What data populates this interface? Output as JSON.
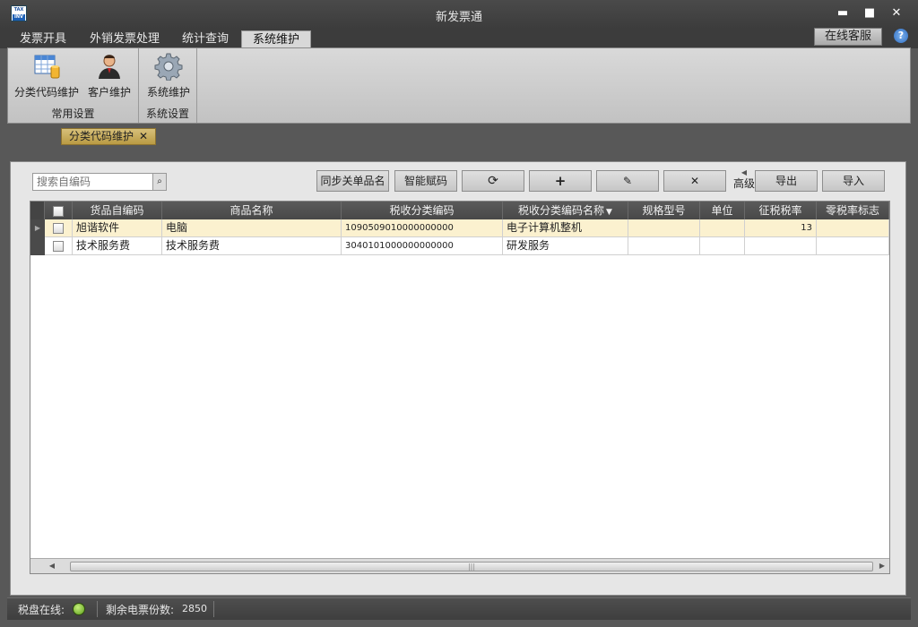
{
  "window": {
    "title": "新发票通",
    "minimize": "▬",
    "maximize": "■",
    "close": "✕"
  },
  "app_icon": {
    "line1": "TAX",
    "line2": "INV"
  },
  "menu": {
    "tabs": [
      "发票开具",
      "外销发票处理",
      "统计查询",
      "系统维护"
    ],
    "active": "系统维护"
  },
  "service_button": "在线客服",
  "help": "?",
  "ribbon": {
    "groups": [
      {
        "label": "常用设置",
        "buttons": [
          {
            "label": "分类代码维护",
            "icon": "spreadsheet-icon"
          },
          {
            "label": "客户维护",
            "icon": "user-icon"
          }
        ]
      },
      {
        "label": "系统设置",
        "buttons": [
          {
            "label": "系统维护",
            "icon": "gear-icon"
          }
        ]
      }
    ]
  },
  "doc_tab": {
    "label": "分类代码维护",
    "close": "✕"
  },
  "toolbar": {
    "search_placeholder": "搜索自编码",
    "sync_label": "同步关单品名",
    "smart_label": "智能赋码",
    "refresh_icon": "⟳",
    "add_icon": "+",
    "edit_icon": "✎",
    "delete_icon": "✕",
    "advanced_label": "高级",
    "export_label": "导出",
    "import_label": "导入"
  },
  "grid": {
    "columns": [
      "货品自编码",
      "商品名称",
      "税收分类编码",
      "税收分类编码名称",
      "规格型号",
      "单位",
      "征税税率",
      "零税率标志"
    ],
    "rows": [
      {
        "code": "旭谐软件",
        "name": "电脑",
        "tax_code": "1090509010000000000",
        "tax_name": "电子计算机整机",
        "spec": "",
        "unit": "",
        "rate": "13",
        "zero": ""
      },
      {
        "code": "技术服务费",
        "name": "技术服务费",
        "tax_code": "3040101000000000000",
        "tax_name": "研发服务",
        "spec": "",
        "unit": "",
        "rate": "",
        "zero": ""
      }
    ],
    "selected_row": 0
  },
  "status": {
    "disk_label": "税盘在线:",
    "disk_online": true,
    "remaining_label": "剩余电票份数:",
    "remaining_value": "2850"
  },
  "colors": {
    "accent_tab": "#c9ae5a",
    "selected_row": "#fbf1cf",
    "led": "#7bc034"
  }
}
